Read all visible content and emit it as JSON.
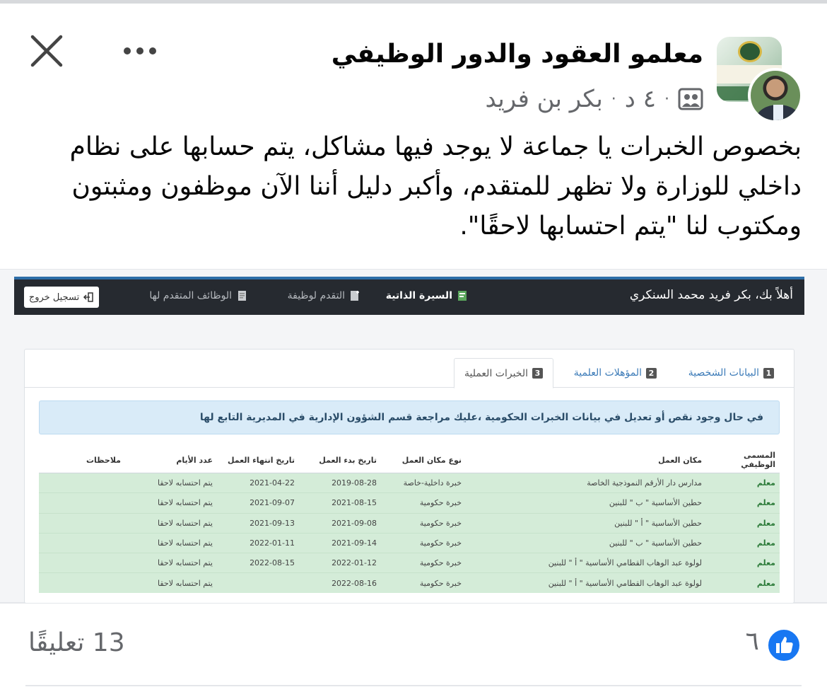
{
  "post": {
    "group_name": "معلمو العقود والدور الوظيفي",
    "author": "بكر بن فريد",
    "separator": "·",
    "time": "٤ د",
    "text": "بخصوص الخبرات يا جماعة لا يوجد فيها مشاكل، يتم حسابها على نظام داخلي للوزارة ولا تظهر للمتقدم، وأكبر دليل أننا الآن موظفون ومثبتون ومكتوب لنا \"يتم احتسابها لاحقًا\"."
  },
  "screenshot": {
    "welcome": "أهلاً بك، بكر فريد محمد السنكري",
    "nav": {
      "cv": "السيرة الذاتية",
      "apply": "التقدم لوظيفة",
      "applied_jobs": "الوظائف المتقدم لها",
      "logout": "تسجيل خروج"
    },
    "tabs": [
      {
        "num": "1",
        "label": "البيانات الشخصية"
      },
      {
        "num": "2",
        "label": "المؤهلات العلمية"
      },
      {
        "num": "3",
        "label": "الخبرات العملية"
      }
    ],
    "alert": "في حال وجود نقص أو تعديل في بيانات الخبرات الحكومية ،عليك مراجعة قسم الشؤون الإدارية في المديرية التابع لها",
    "table": {
      "headers": [
        "المسمى الوظيفي",
        "مكان العمل",
        "نوع مكان العمل",
        "تاريخ بدء العمل",
        "تاريخ انتهاء العمل",
        "عدد الأيام",
        "ملاحظات"
      ],
      "rows": [
        [
          "معلم",
          "مدارس دار الأرقم النموذجية الخاصة",
          "خبرة داخلية-خاصة",
          "2019-08-28",
          "2021-04-22",
          "يتم احتسابه لاحقا",
          ""
        ],
        [
          "معلم",
          "حطين الأساسية \" ب \" للبنين",
          "خبرة حكومية",
          "2021-08-15",
          "2021-09-07",
          "يتم احتسابه لاحقا",
          ""
        ],
        [
          "معلم",
          "حطين الأساسية \" أ \" للبنين",
          "خبرة حكومية",
          "2021-09-08",
          "2021-09-13",
          "يتم احتسابه لاحقا",
          ""
        ],
        [
          "معلم",
          "حطين الأساسية \" ب \" للبنين",
          "خبرة حكومية",
          "2021-09-14",
          "2022-01-11",
          "يتم احتسابه لاحقا",
          ""
        ],
        [
          "معلم",
          "لولوة عبد الوهاب القطامي الأساسية \" أ \" للبنين",
          "خبرة حكومية",
          "2022-01-12",
          "2022-08-15",
          "يتم احتسابه لاحقا",
          ""
        ],
        [
          "معلم",
          "لولوة عبد الوهاب القطامي الأساسية \" أ \" للبنين",
          "خبرة حكومية",
          "2022-08-16",
          "",
          "يتم احتسابه لاحقا",
          ""
        ]
      ]
    }
  },
  "footer": {
    "reactions": "٦",
    "comments": "13 تعليقًا"
  },
  "colors": {
    "like_blue": "#1877f2",
    "row_green": "#d4ecd8",
    "nav_dark": "#262a30"
  }
}
